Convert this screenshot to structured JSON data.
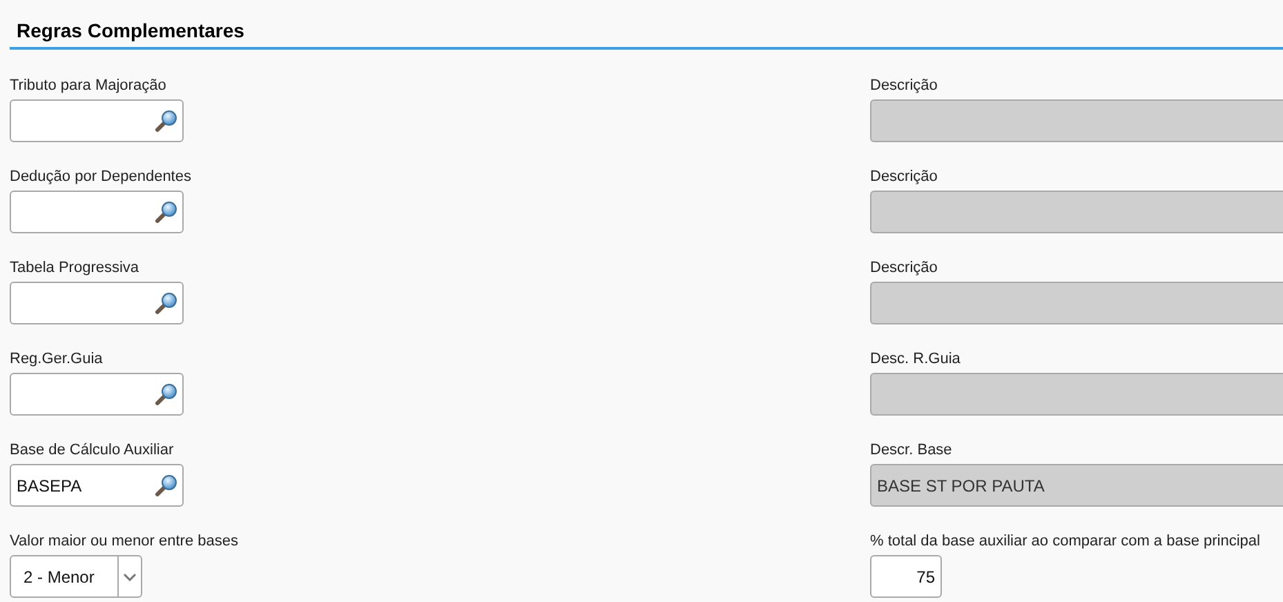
{
  "section": {
    "title": "Regras Complementares"
  },
  "rows": [
    {
      "left": {
        "label": "Tributo para Majoração",
        "kind": "lookup"
      },
      "right": {
        "label": "Descrição",
        "kind": "readonly"
      }
    },
    {
      "left": {
        "label": "Dedução por Dependentes",
        "kind": "lookup"
      },
      "right": {
        "label": "Descrição",
        "kind": "readonly"
      }
    },
    {
      "left": {
        "label": "Tabela Progressiva",
        "kind": "lookup"
      },
      "right": {
        "label": "Descrição",
        "kind": "readonly"
      }
    },
    {
      "left": {
        "label": "Reg.Ger.Guia",
        "kind": "lookup"
      },
      "right": {
        "label": "Desc. R.Guia",
        "kind": "readonly"
      }
    },
    {
      "left": {
        "label": "Base de Cálculo Auxiliar",
        "kind": "lookup",
        "value": "BASEPA"
      },
      "right": {
        "label": "Descr. Base",
        "kind": "readonly",
        "value": "BASE ST POR PAUTA"
      }
    },
    {
      "left": {
        "label": "Valor maior ou menor entre bases",
        "kind": "select",
        "value": "2 - Menor"
      },
      "right": {
        "label": "% total da base auxiliar ao comparar com a base principal",
        "kind": "number",
        "value": "75"
      }
    }
  ]
}
